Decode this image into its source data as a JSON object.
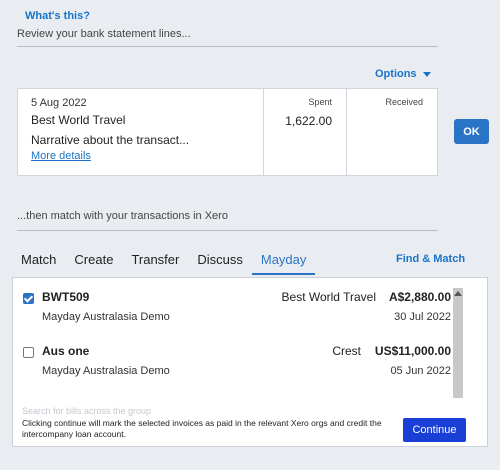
{
  "header": {
    "whats_this": "What's this?",
    "review_text": "Review your bank statement lines..."
  },
  "options_label": "Options",
  "statement": {
    "date": "5 Aug 2022",
    "payee": "Best World Travel",
    "narrative": "Narrative about the transact...",
    "more_details": "More details",
    "spent_header": "Spent",
    "received_header": "Received",
    "spent": "1,622.00",
    "received": ""
  },
  "ok_label": "OK",
  "match_text": "...then match with your transactions in Xero",
  "tabs": [
    {
      "label": "Match",
      "active": false
    },
    {
      "label": "Create",
      "active": false
    },
    {
      "label": "Transfer",
      "active": false
    },
    {
      "label": "Discuss",
      "active": false
    },
    {
      "label": "Mayday",
      "active": true
    }
  ],
  "find_match": "Find & Match",
  "transactions": [
    {
      "checked": true,
      "code": "BWT509",
      "org": "Mayday Australasia Demo",
      "payee": "Best World Travel",
      "amount": "A$2,880.00",
      "date": "30 Jul 2022"
    },
    {
      "checked": false,
      "code": "Aus one",
      "org": "Mayday Australasia Demo",
      "payee": "Crest",
      "amount": "US$11,000.00",
      "date": "05 Jun 2022"
    }
  ],
  "search_hint": "Search for bills across the group",
  "footer_note": "Clicking continue will mark the selected invoices as paid in the relevant Xero orgs and credit the intercompany loan account.",
  "continue_label": "Continue",
  "colors": {
    "accent": "#2a74c6",
    "continue": "#1a3fd6",
    "background": "#e9edf2"
  }
}
